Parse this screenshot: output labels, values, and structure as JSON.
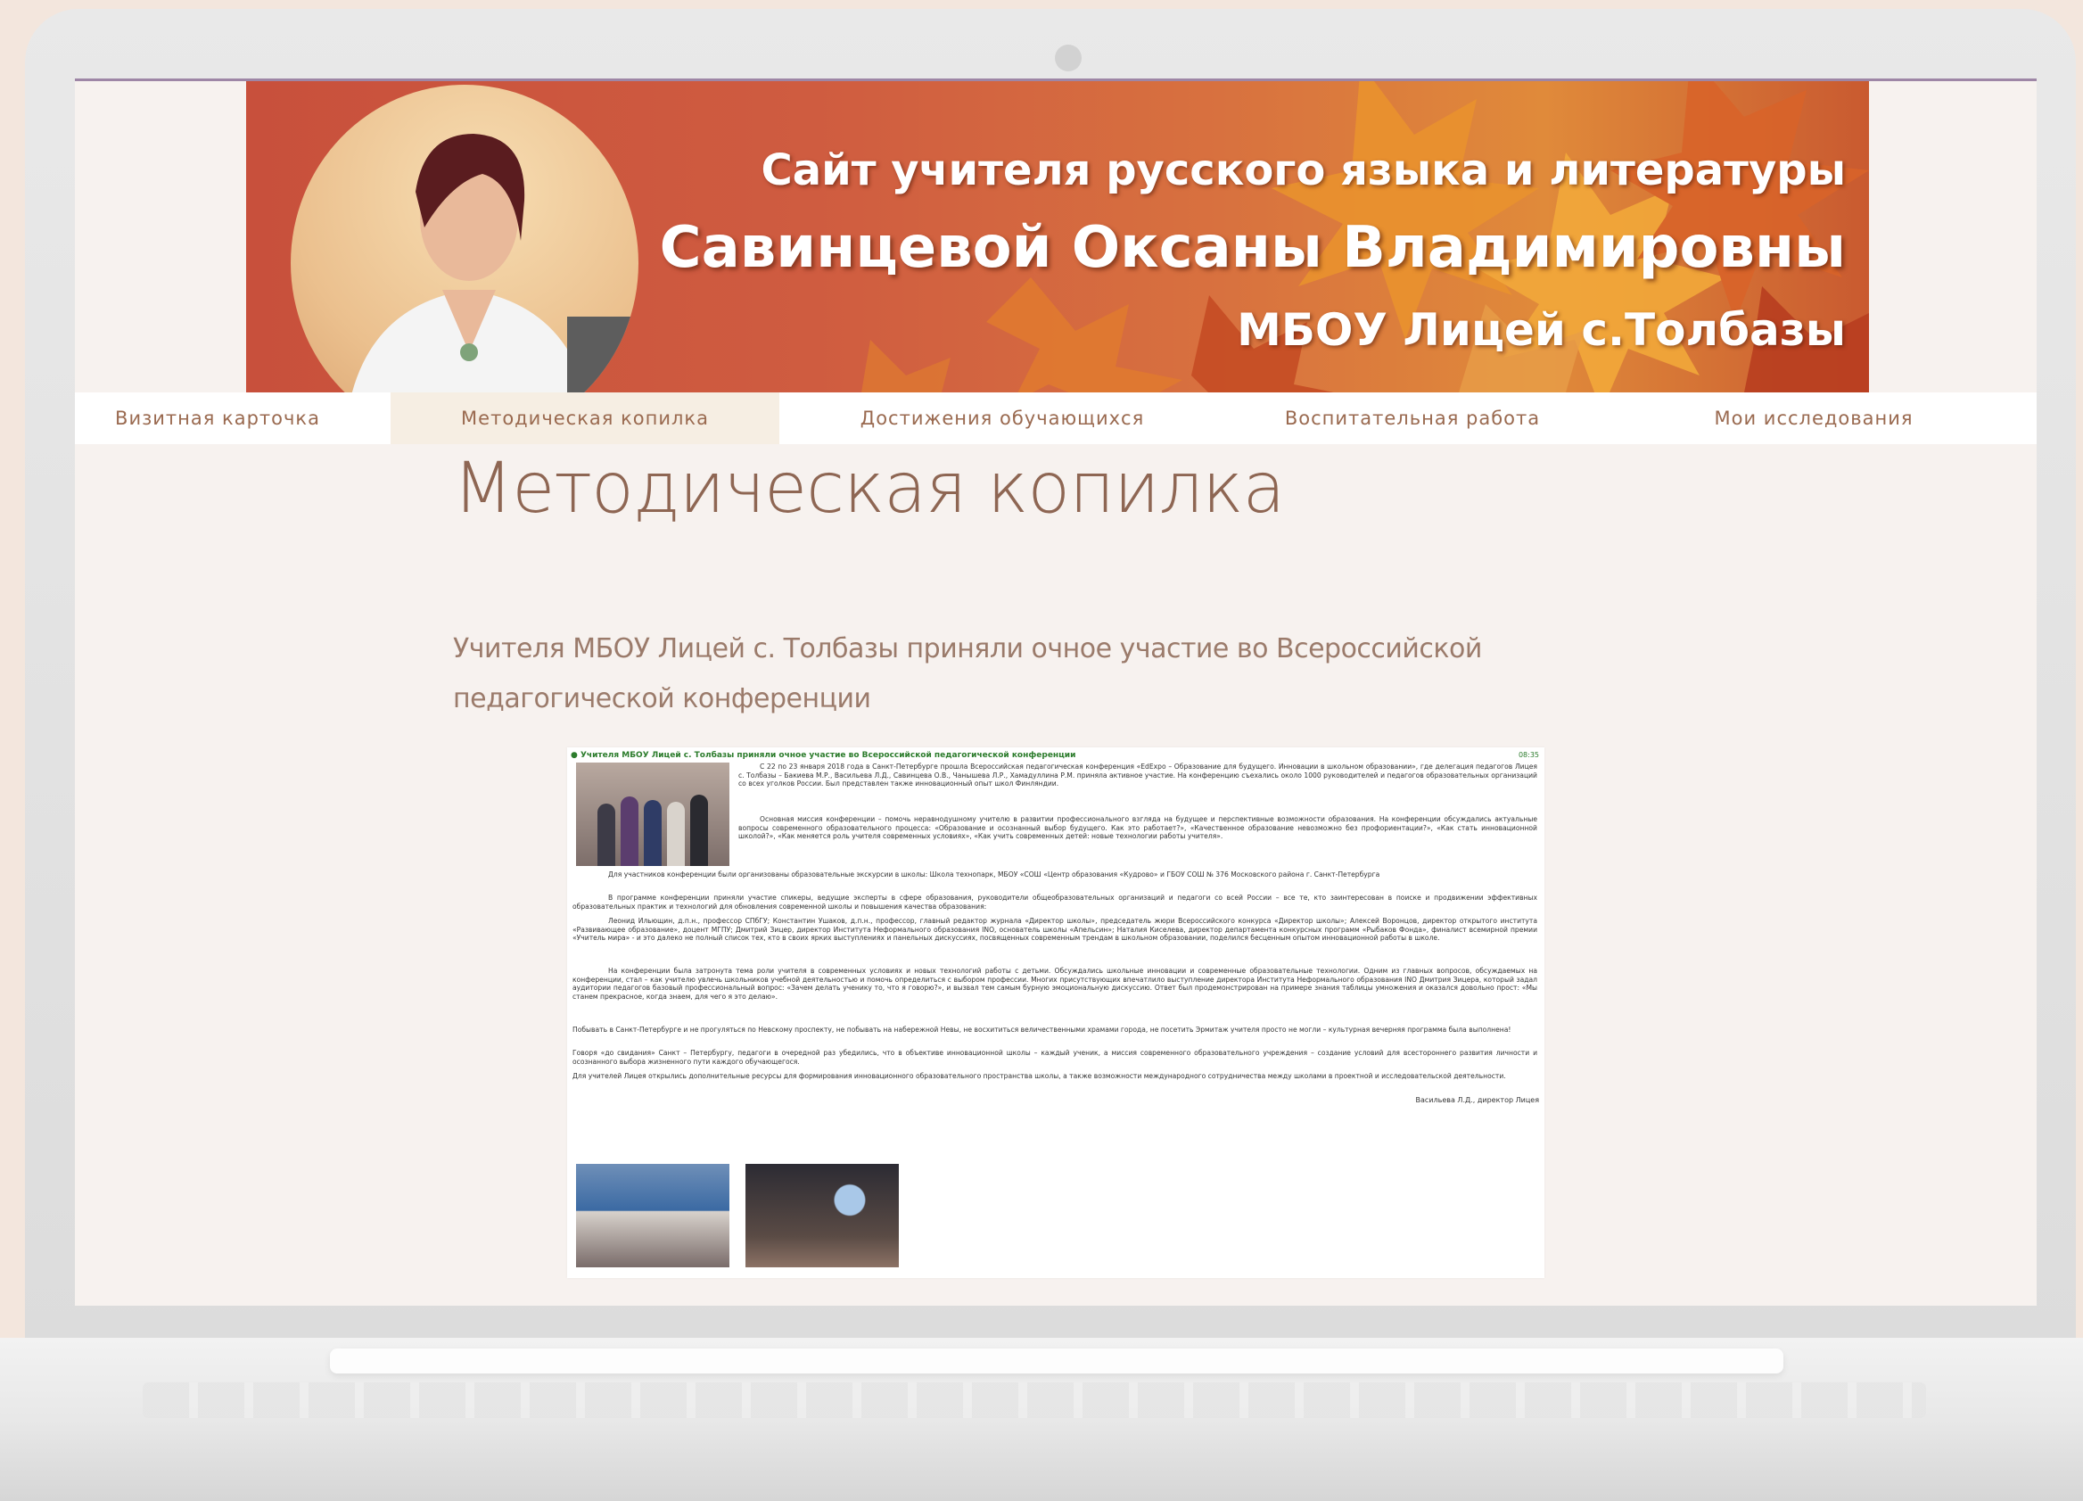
{
  "banner": {
    "line1": "Сайт учителя русского языка и литературы",
    "line2": "Савинцевой Оксаны Владимировны",
    "line3": "МБОУ Лицей с.Толбазы"
  },
  "nav": {
    "items": [
      {
        "label": "Визитная карточка"
      },
      {
        "label": "Методическая копилка"
      },
      {
        "label": "Достижения обучающихся"
      },
      {
        "label": "Воспитательная работа"
      },
      {
        "label": "Мои исследования"
      }
    ],
    "active": "Методическая копилка"
  },
  "page": {
    "title": "Методическая копилка"
  },
  "article": {
    "title": "Учителя МБОУ Лицей с. Толбазы приняли очное участие во Всероссийской педагогической конференции",
    "doc_header": "● Учителя МБОУ Лицей с. Толбазы приняли очное участие во Всероссийской педагогической конференции",
    "doc_time": "08:35",
    "p1": "С 22 по 23 января 2018 года в Санкт-Петербурге прошла Всероссийская педагогическая конференция «EdExpo – Образование для будущего. Инновации в школьном образовании», где делегация педагогов Лицея с. Толбазы – Бакиева М.Р., Васильева Л.Д., Савинцева О.В., Чанышева Л.Р., Хамадуллина Р.М. приняла активное участие. На конференцию съехались около 1000 руководителей и педагогов образовательных организаций со всех уголков России. Был представлен также инновационный опыт школ Финляндии.",
    "p2": "Основная миссия конференции – помочь неравнодушному учителю в развитии профессионального взгляда на будущее и перспективные возможности образования. На конференции обсуждались актуальные вопросы современного образовательного процесса: «Образование и осознанный выбор будущего. Как это работает?», «Качественное образование невозможно без профориентации?», «Как стать инновационной школой?», «Как меняется роль учителя современных условиях», «Как учить современных детей: новые технологии работы учителя».",
    "p3": "Для участников конференции были организованы образовательные экскурсии в школы: Школа технопарк, МБОУ «СОШ «Центр образования «Кудрово» и ГБОУ СОШ № 376 Московского района г. Санкт-Петербурга",
    "p4": "В программе конференции приняли участие спикеры, ведущие эксперты в сфере образования, руководители общеобразовательных организаций и педагоги со всей России – все те, кто заинтересован в поиске и продвижении эффективных образовательных практик и технологий для обновления современной школы и повышения качества образования:",
    "p5": "Леонид Ильющин, д.п.н., профессор СПбГУ; Константин Ушаков, д.п.н., профессор, главный редактор журнала «Директор школы», председатель жюри Всероссийского конкурса «Директор школы»; Алексей Воронцов, директор открытого института «Развивающее образование», доцент МГПУ; Дмитрий Зицер, директор Института Неформального образования INO, основатель школы «Апельсин»; Наталия Киселева, директор департамента конкурсных программ «Рыбаков Фонда», финалист всемирной премии «Учитель мира» - и это далеко не полный список тех, кто в своих ярких выступлениях и панельных дискуссиях, посвященных современным трендам в школьном образовании, поделился бесценным опытом инновационной работы в школе.",
    "p6": "На конференции была затронута тема роли учителя в современных условиях и новых технологий работы с детьми. Обсуждались школьные инновации и современные образовательные технологии. Одним из главных вопросов, обсуждаемых на конференции, стал – как учителю увлечь школьников учебной деятельностью и помочь определиться с выбором профессии. Многих присутствующих впечатлило выступление директора Института Неформального образования INO Дмитрия Зицера, который задал аудитории педагогов базовый профессиональный вопрос: «Зачем делать ученику то, что я говорю?», и вызвал тем самым бурную эмоциональную дискуссию. Ответ был продемонстрирован на примере знания таблицы умножения и оказался довольно прост: «Мы станем прекрасное, когда знаем, для чего я это делаю».",
    "p7": "Побывать в Санкт-Петербурге и не прогуляться по Невскому проспекту, не побывать на набережной Невы, не восхититься величественными храмами города, не посетить Эрмитаж учителя просто не могли – культурная вечерняя программа была выполнена!",
    "p8": "Говоря «до свидания» Санкт – Петербургу, педагоги в очередной раз убедились, что в объективе инновационной школы – каждый ученик, а миссия современного образовательного учреждения – создание условий для всестороннего развития личности и осознанного выбора жизненного пути каждого обучающегося.",
    "p9": "Для учителей Лицея открылись дополнительные ресурсы для формирования инновационного образовательного пространства школы, а также возможности международного сотрудничества между школами в проектной и исследовательской деятельности.",
    "signature": "Васильева Л.Д., директор Лицея"
  },
  "colors": {
    "banner": "#c8503c",
    "nav_text": "#9a6a50",
    "title_text": "#8e6653",
    "doc_header": "#2c7c2c"
  }
}
